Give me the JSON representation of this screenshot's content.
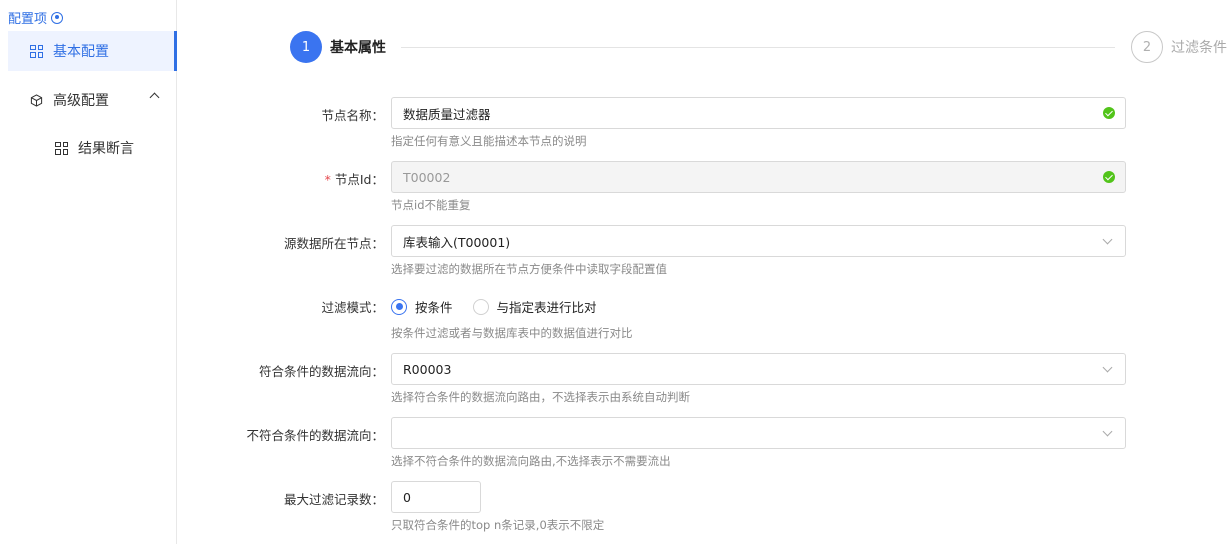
{
  "sidebar": {
    "title": "配置项",
    "items": [
      {
        "label": "基本配置",
        "icon": "grid-icon"
      },
      {
        "label": "高级配置",
        "icon": "cube-icon"
      },
      {
        "label": "结果断言",
        "icon": "grid-icon"
      }
    ]
  },
  "steps": [
    {
      "number": "1",
      "label": "基本属性"
    },
    {
      "number": "2",
      "label": "过滤条件"
    }
  ],
  "form": {
    "node_name": {
      "label": "节点名称：",
      "value": "数据质量过滤器",
      "help": "指定任何有意义且能描述本节点的说明"
    },
    "node_id": {
      "required": "*",
      "label": "节点Id：",
      "value": "T00002",
      "help": "节点id不能重复"
    },
    "source_node": {
      "label": "源数据所在节点：",
      "value": "库表输入(T00001)",
      "help": "选择要过滤的数据所在节点方便条件中读取字段配置值"
    },
    "filter_mode": {
      "label": "过滤模式：",
      "options": [
        "按条件",
        "与指定表进行比对"
      ],
      "selected": "按条件",
      "help": "按条件过滤或者与数据库表中的数据值进行对比"
    },
    "match_flow": {
      "label": "符合条件的数据流向：",
      "value": "R00003",
      "help": "选择符合条件的数据流向路由，不选择表示由系统自动判断"
    },
    "unmatch_flow": {
      "label": "不符合条件的数据流向：",
      "value": "",
      "help": "选择不符合条件的数据流向路由,不选择表示不需要流出"
    },
    "max_records": {
      "label": "最大过滤记录数：",
      "value": "0",
      "help": "只取符合条件的top n条记录,0表示不限定"
    }
  },
  "colors": {
    "accent": "#3a74f0",
    "success": "#52c41a",
    "required": "#e5484d"
  }
}
